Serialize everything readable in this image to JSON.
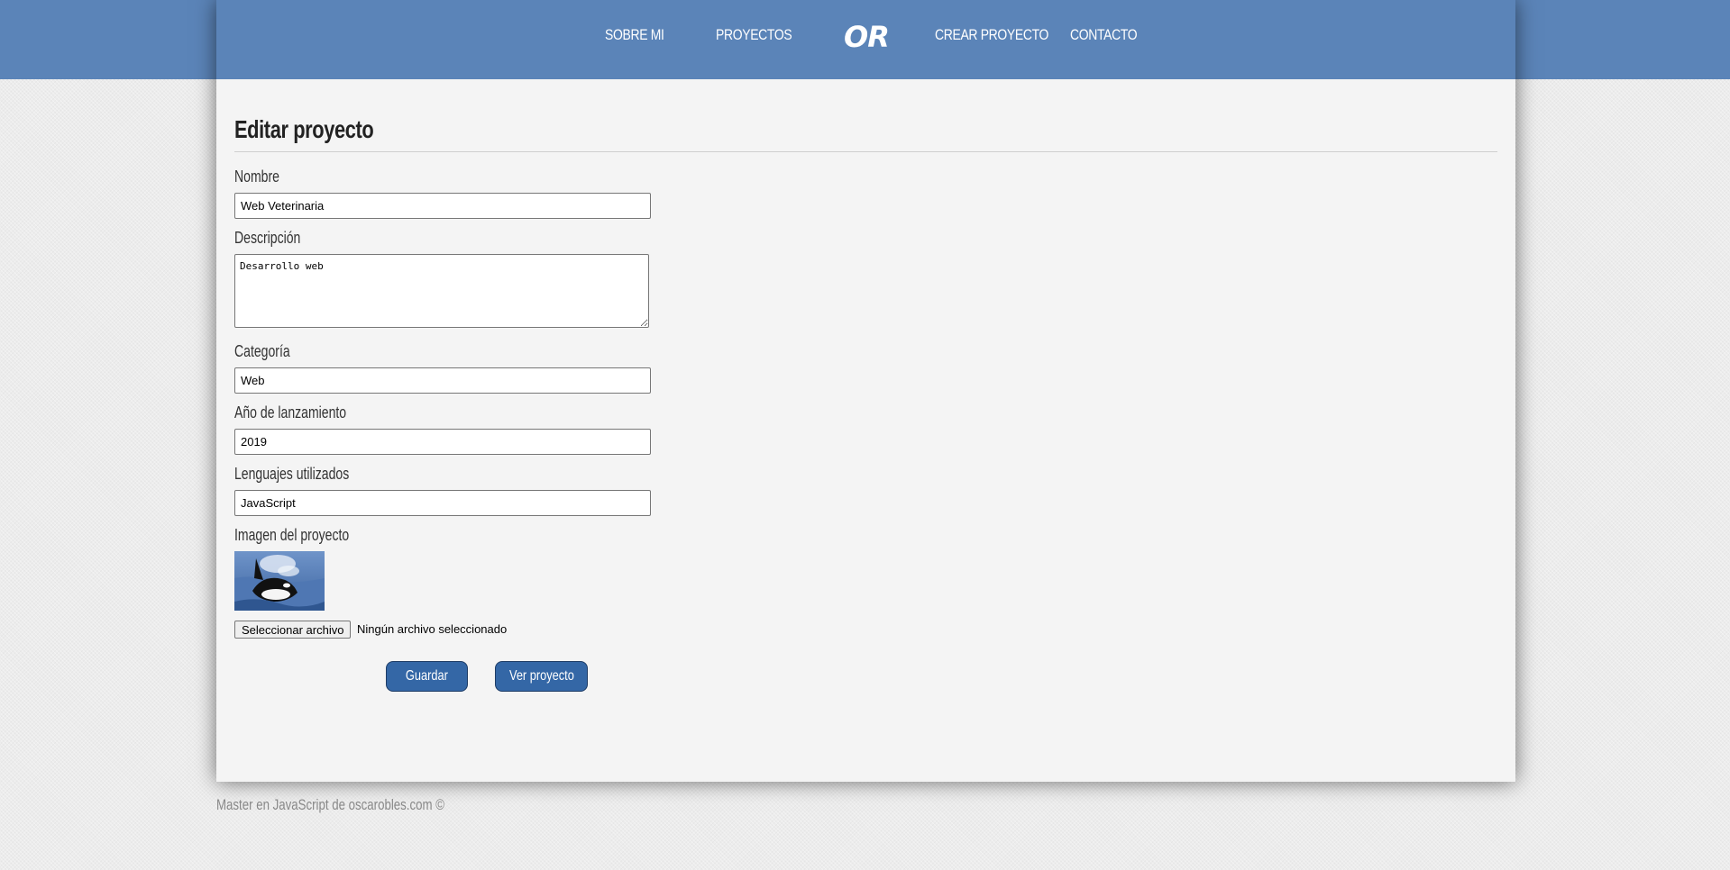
{
  "nav": {
    "items": [
      "SOBRE MI",
      "PROYECTOS",
      "CREAR PROYECTO",
      "CONTACTO"
    ],
    "logo": "OR"
  },
  "form": {
    "title": "Editar proyecto",
    "nombre": {
      "label": "Nombre",
      "value": "Web Veterinaria"
    },
    "descripcion": {
      "label": "Descripción",
      "value": "Desarrollo web"
    },
    "categoria": {
      "label": "Categoría",
      "value": "Web"
    },
    "anio": {
      "label": "Año de lanzamiento",
      "value": "2019"
    },
    "lenguajes": {
      "label": "Lenguajes utilizados",
      "value": "JavaScript"
    },
    "imagen": {
      "label": "Imagen del proyecto",
      "file_button": "Seleccionar archivo",
      "file_status": "Ningún archivo seleccionado"
    },
    "save_label": "Guardar",
    "view_label": "Ver proyecto"
  },
  "footer": {
    "text": "Master en JavaScript de oscarobles.com ©"
  },
  "colors": {
    "brand": "#5b84b8",
    "button": "#3467a6"
  }
}
